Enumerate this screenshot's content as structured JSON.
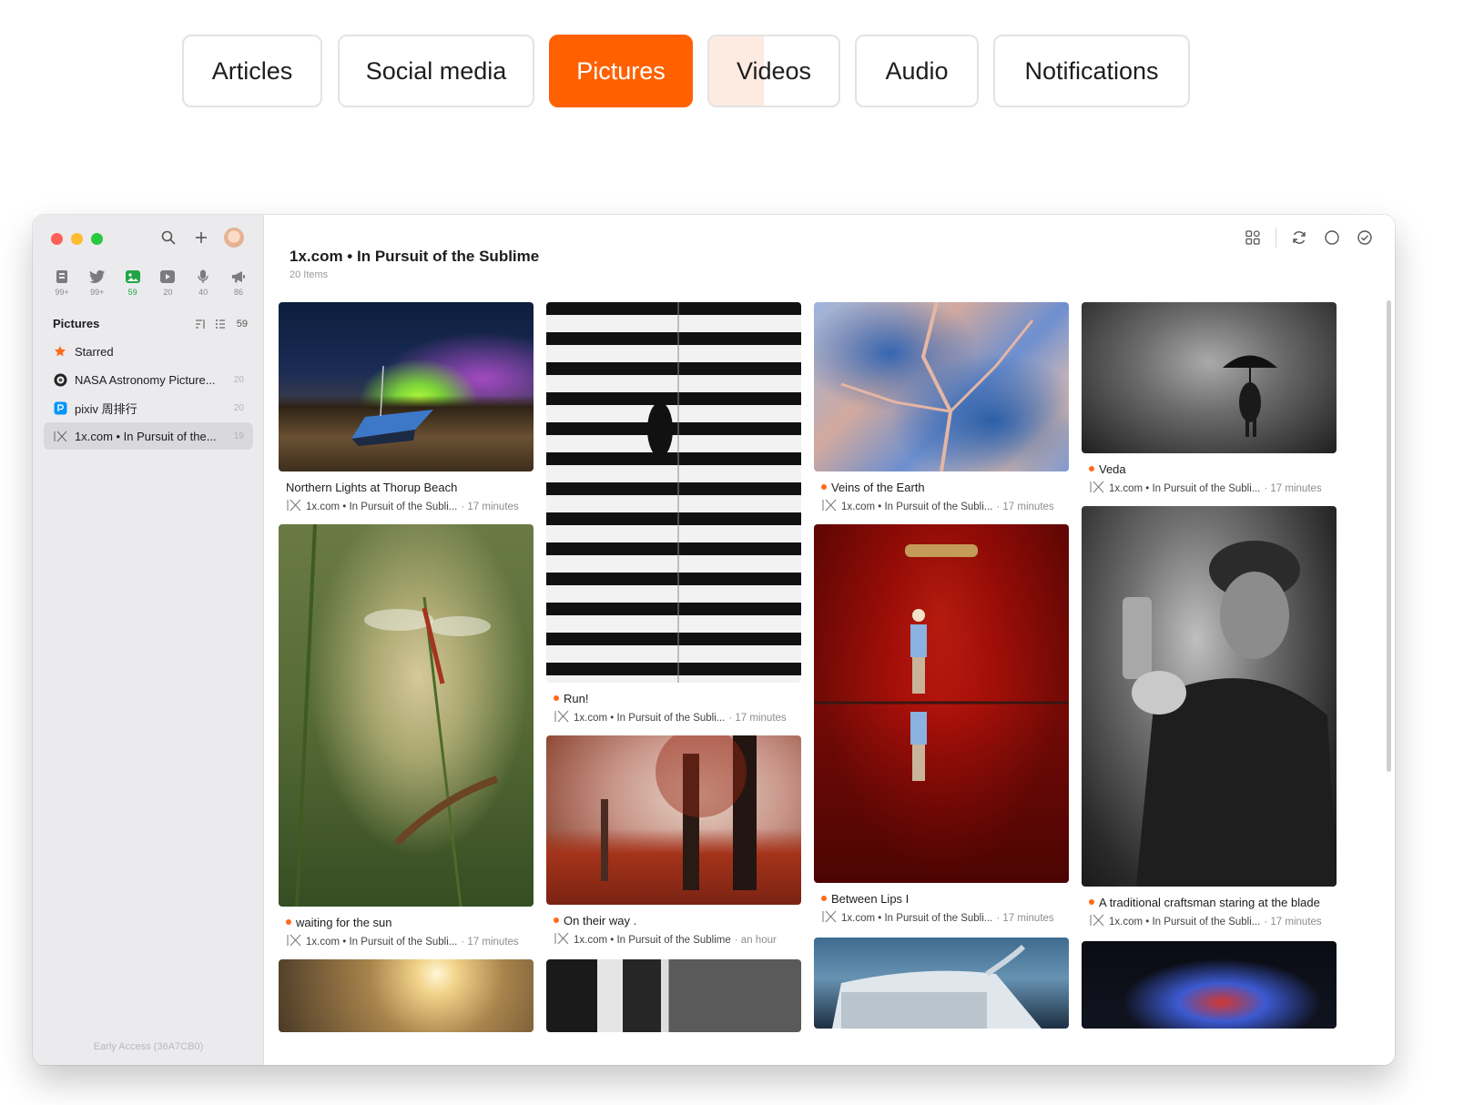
{
  "tabs": [
    {
      "label": "Articles"
    },
    {
      "label": "Social media"
    },
    {
      "label": "Pictures"
    },
    {
      "label": "Videos"
    },
    {
      "label": "Audio"
    },
    {
      "label": "Notifications"
    }
  ],
  "colors": {
    "accent": "#ff6100",
    "unread_dot": "#ff6a1a",
    "active_count": "#22a547"
  },
  "sidebar": {
    "categories": [
      {
        "icon": "article-icon",
        "count": "99+"
      },
      {
        "icon": "twitter-icon",
        "count": "99+"
      },
      {
        "icon": "picture-icon",
        "count": "59"
      },
      {
        "icon": "video-icon",
        "count": "20"
      },
      {
        "icon": "microphone-icon",
        "count": "40"
      },
      {
        "icon": "megaphone-icon",
        "count": "86"
      }
    ],
    "section_title": "Pictures",
    "section_count": "59",
    "feeds": [
      {
        "icon": "star-icon",
        "label": "Starred",
        "count": ""
      },
      {
        "icon": "nasa-icon",
        "label": "NASA Astronomy Picture...",
        "count": "20"
      },
      {
        "icon": "pixiv-icon",
        "label": "pixiv 周排行",
        "count": "20"
      },
      {
        "icon": "1x-icon",
        "label": "1x.com • In Pursuit of the...",
        "count": "19"
      }
    ],
    "footer": "Early Access (36A7CB0)"
  },
  "main": {
    "title": "1x.com • In Pursuit of the Sublime",
    "subtitle": "20 Items",
    "cards": [
      {
        "caption": "Northern Lights at Thorup Beach",
        "unread": false,
        "source": "1x.com • In Pursuit of the Subli...",
        "time": "· 17 minutes"
      },
      {
        "caption": "waiting for the sun",
        "unread": true,
        "source": "1x.com • In Pursuit of the Subli...",
        "time": "· 17 minutes"
      },
      {
        "caption": "Run!",
        "unread": true,
        "source": "1x.com • In Pursuit of the Subli...",
        "time": "· 17 minutes"
      },
      {
        "caption": "On their way .",
        "unread": true,
        "source": "1x.com • In Pursuit of the Sublime",
        "time": "· an hour"
      },
      {
        "caption": "Veins of the Earth",
        "unread": true,
        "source": "1x.com • In Pursuit of the Subli...",
        "time": "· 17 minutes"
      },
      {
        "caption": "Between Lips I",
        "unread": true,
        "source": "1x.com • In Pursuit of the Subli...",
        "time": "· 17 minutes"
      },
      {
        "caption": "Veda",
        "unread": true,
        "source": "1x.com • In Pursuit of the Subli...",
        "time": "· 17 minutes"
      },
      {
        "caption": "A traditional craftsman staring at the blade",
        "unread": true,
        "source": "1x.com • In Pursuit of the Subli...",
        "time": "· 17 minutes"
      }
    ]
  }
}
